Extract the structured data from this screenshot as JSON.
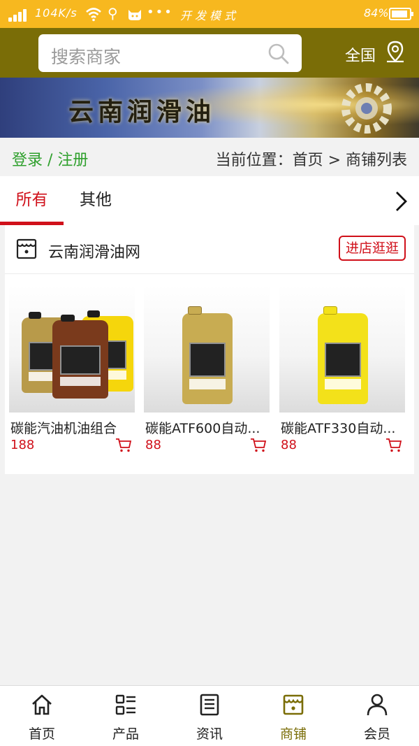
{
  "status_bar": {
    "speed": "104K/s",
    "mode": "开发模式",
    "battery": "84%",
    "battery_level": 0.84,
    "icons": [
      "signal-icon",
      "wifi-icon",
      "usb-icon",
      "cat-icon",
      "more-dots-icon",
      "battery-icon"
    ]
  },
  "header": {
    "search_placeholder": "搜索商家",
    "region": "全国",
    "colors": {
      "header": "#7a6d07",
      "status_bar": "#f7b81f"
    }
  },
  "banner": {
    "title": "云南润滑油"
  },
  "breadcrumb_row": {
    "login": "登录 / 注册",
    "location": "当前位置：首页 > 商铺列表"
  },
  "tabs": {
    "items": [
      {
        "label": "所有",
        "active": true
      },
      {
        "label": "其他",
        "active": false
      }
    ],
    "accent": "#d0101a"
  },
  "shop": {
    "name": "云南润滑油网",
    "enter_label": "进店逛逛",
    "products": [
      {
        "name": "碳能汽油机油组合",
        "price": "188"
      },
      {
        "name": "碳能ATF600自动...",
        "price": "88"
      },
      {
        "name": "碳能ATF330自动...",
        "price": "88"
      }
    ]
  },
  "bottom_nav": {
    "items": [
      {
        "label": "首页",
        "icon": "home-icon",
        "active": false
      },
      {
        "label": "产品",
        "icon": "list-icon",
        "active": false
      },
      {
        "label": "资讯",
        "icon": "news-icon",
        "active": false
      },
      {
        "label": "商铺",
        "icon": "shop-icon",
        "active": true
      },
      {
        "label": "会员",
        "icon": "user-icon",
        "active": false
      }
    ]
  }
}
